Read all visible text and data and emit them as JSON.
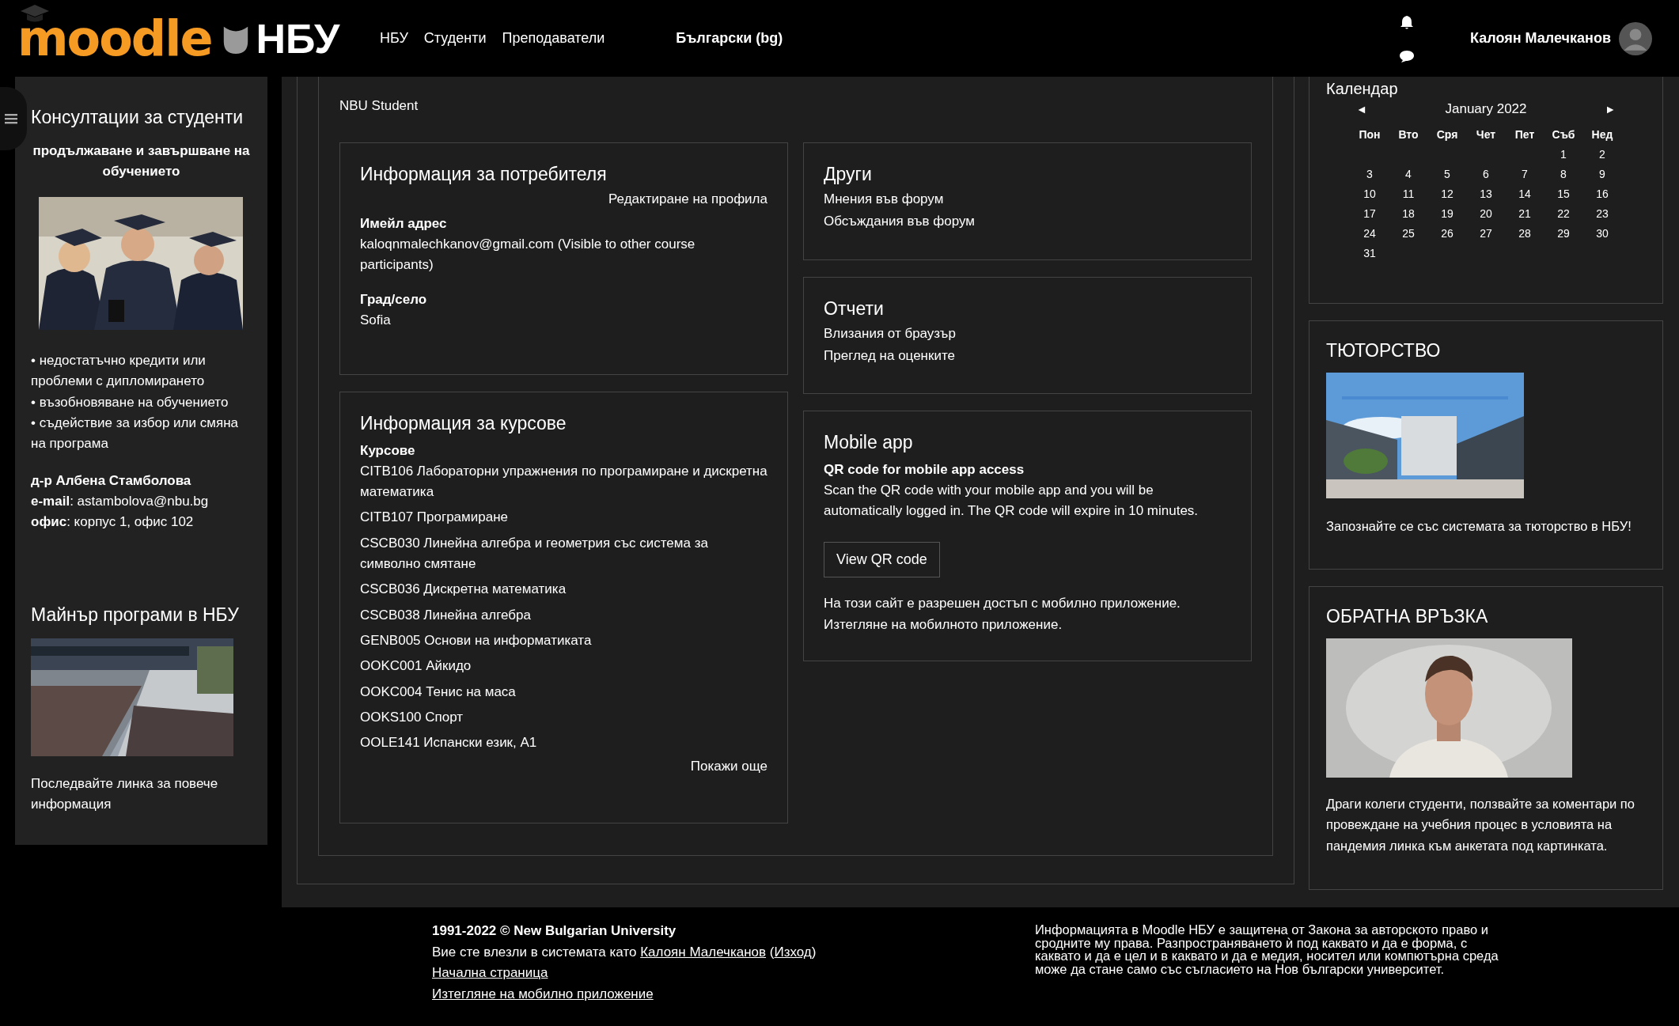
{
  "header": {
    "logo_text": "moodle",
    "logo_suffix": "НБУ",
    "nav": [
      {
        "label": "НБУ"
      },
      {
        "label": "Студенти"
      },
      {
        "label": "Преподаватели"
      }
    ],
    "language": "Български (bg)",
    "user_name": "Калоян Малечканов"
  },
  "left_sidebar": {
    "blocks": [
      {
        "kind": "consult",
        "title": "Консултации за студенти",
        "subtitle": "продължаване и завършване на обучението",
        "bullets": [
          "• недостатъчно кредити или проблеми с дипломирането",
          "• възобновяване на обучението",
          "• съдействие за избор или смяна на програма"
        ],
        "contact": [
          "**д-р Албена Стамболова**",
          "**e-mail**: astambolova@nbu.bg",
          "**офис**: корпус 1, офис 102"
        ]
      },
      {
        "kind": "minor",
        "title": "Майнър програми в НБУ",
        "text": "Последвайте линка за повече информация"
      }
    ]
  },
  "profile": {
    "role": "NBU Student",
    "user_info": {
      "title": "Информация за потребителя",
      "edit_link": "Редактиране на профила",
      "fields": [
        {
          "label": "Имейл адрес",
          "value": "kaloqnmalechkanov@gmail.com (Visible to other course participants)"
        },
        {
          "label": "Град/село",
          "value": "Sofia"
        }
      ]
    },
    "courses": {
      "title": "Информация за курсове",
      "label": "Курсове",
      "items": [
        "CITB106 Лабораторни упражнения по програмиране и дискретна математика",
        "CITB107 Програмиране",
        "CSCB030 Линейна алгебра и геометрия със система за символно смятане",
        "CSCB036 Дискретна математика",
        "CSCB038 Линейна алгебра",
        "GENB005 Основи на информатиката",
        "OOKC001 Айкидо",
        "OOKC004 Тенис на маса",
        "OOKS100 Спорт",
        "OOLE141 Испански език, A1"
      ],
      "more": "Покажи още"
    },
    "others": {
      "title": "Други",
      "links": [
        "Мнения във форум",
        "Обсъждания във форум"
      ]
    },
    "reports": {
      "title": "Отчети",
      "links": [
        "Влизания от браузър",
        "Преглед на оценките"
      ]
    },
    "mobile": {
      "title": "Mobile app",
      "subtitle": "QR code for mobile app access",
      "text": "Scan the QR code with your mobile app and you will be automatically logged in. The QR code will expire in 10 minutes.",
      "button": "View QR code",
      "note": "На този сайт е разрешен достъп с мобилно приложение.",
      "download_link": "Изтегляне на мобилното приложение."
    }
  },
  "calendar": {
    "title": "Календар",
    "prev": "◄",
    "next": "►",
    "month": "January 2022",
    "weekdays": [
      "Пон",
      "Вто",
      "Сря",
      "Чет",
      "Пет",
      "Съб",
      "Нед"
    ],
    "weeks": [
      {
        "kind": "partial",
        "days": [
          "1",
          "2"
        ]
      },
      {
        "kind": "full",
        "days": [
          "3",
          "4",
          "5",
          "6",
          "7",
          "8",
          "9"
        ]
      },
      {
        "kind": "full",
        "days": [
          "10",
          "11",
          "12",
          "13",
          "14",
          "15",
          "16"
        ]
      },
      {
        "kind": "full",
        "days": [
          "17",
          "18",
          "19",
          "20",
          "21",
          "22",
          "23"
        ]
      },
      {
        "kind": "full",
        "days": [
          "24",
          "25",
          "26",
          "27",
          "28",
          "29",
          "30"
        ]
      },
      {
        "kind": "full",
        "days": [
          "31"
        ]
      }
    ]
  },
  "right_blocks": [
    {
      "kind": "tutor",
      "title": "ТЮТОРСТВО",
      "text": "Запознайте се със системата за тюторство в НБУ!"
    },
    {
      "kind": "feedback",
      "title": "ОБРАТНА ВРЪЗКА",
      "text": "Драги колеги студенти, ползвайте за коментари по провеждане на учебния процес в условията на пандемия линка към анкетата под картинката."
    }
  ],
  "footer": {
    "copyright": "1991-2022 © New Bulgarian University",
    "login_prefix": "Вие сте влезли в системата като ",
    "login_user": "Калоян Малечканов",
    "paren_open": " (",
    "logout": "Изход",
    "paren_close": ")",
    "links": [
      "Начална страница",
      "Изтегляне на мобилно приложение"
    ],
    "notice": "Информацията в Moodle НБУ е защитена от Закона за авторското право и сродните му права. Разпространяването ѝ под каквато и да е форма, с каквато и да е цел и в каквато и да е медия, носител или компютърна среда може да стане само със съгласието на Нов български университет."
  }
}
